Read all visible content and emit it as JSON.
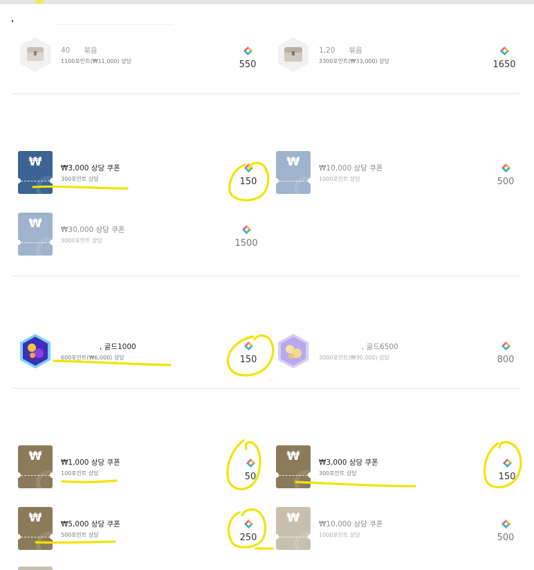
{
  "colors": {
    "highlight": "#f5e94a",
    "divider": "#e2e2e2",
    "coupon_blue_dark": "#3c6393",
    "coupon_blue_light": "#9fb3cc",
    "coupon_gold_dark": "#8b7b5b",
    "coupon_gold_light": "#c8bfae"
  },
  "section_chests": {
    "items": [
      {
        "title": "40",
        "title_tail": "묶음",
        "sub": "1100포인트(₩11,000) 상당",
        "price": "550",
        "icon": "treasure-chest-icon"
      },
      {
        "title": "1,20",
        "title_tail": "묶음",
        "sub": "3300포인트(₩33,000) 상당",
        "price": "1650",
        "icon": "treasure-chest-icon"
      }
    ]
  },
  "section_blue_coupons": {
    "items": [
      {
        "symbol": "₩",
        "title": "₩3,000 상당 쿠폰",
        "sub": "300포인트 상당",
        "price": "150"
      },
      {
        "symbol": "₩",
        "title": "₩10,000 상당 쿠폰",
        "sub": "1000포인트 상당",
        "price": "500"
      },
      {
        "symbol": "₩",
        "title": "₩30,000 상당 쿠폰",
        "sub": "3000포인트 상당",
        "price": "1500"
      }
    ]
  },
  "section_gold": {
    "items": [
      {
        "title": ", 골드1000",
        "sub": "600포인트(₩6,000) 상당",
        "price": "150",
        "icon": "gold-coins-icon"
      },
      {
        "title": ", 골드6500",
        "sub": "3000포인트(₩30,000) 상당",
        "price": "800",
        "icon": "gold-coins-icon"
      }
    ]
  },
  "section_gold_coupons": {
    "items": [
      {
        "symbol": "₩",
        "title": "₩1,000 상당 쿠폰",
        "sub": "100포인트 상당",
        "price": "50"
      },
      {
        "symbol": "₩",
        "title": "₩3,000 상당 쿠폰",
        "sub": "300포인트 상당",
        "price": "150"
      },
      {
        "symbol": "₩",
        "title": "₩5,000 상당 쿠폰",
        "sub": "500포인트 상당",
        "price": "250"
      },
      {
        "symbol": "₩",
        "title": "₩10,000 상당 쿠폰",
        "sub": "1000포인트 상당",
        "price": "500"
      }
    ]
  }
}
